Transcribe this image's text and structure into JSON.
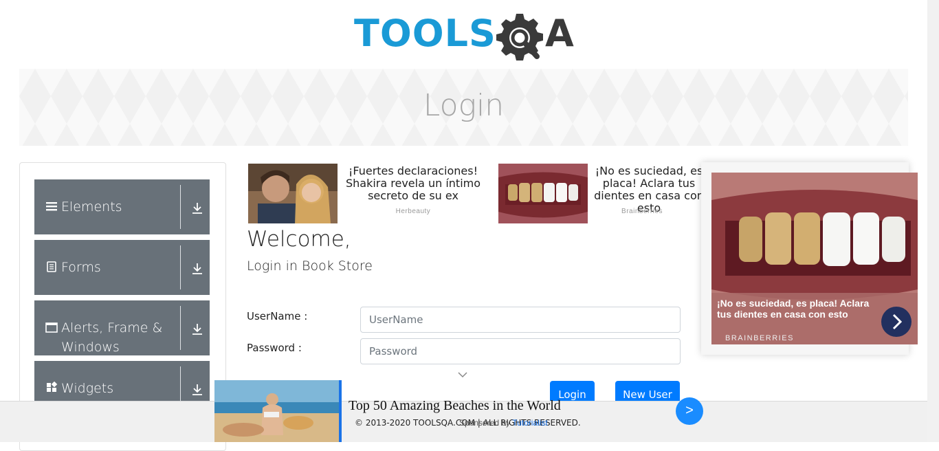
{
  "header": {
    "logo_text": "TOOLS",
    "logo_suffix": "A"
  },
  "banner": {
    "title": "Login"
  },
  "sidebar": {
    "groups": [
      {
        "label": "Elements",
        "icon": "hamburger-icon"
      },
      {
        "label": "Forms",
        "icon": "document-icon"
      },
      {
        "label": "Alerts, Frame & Windows",
        "icon": "window-icon"
      },
      {
        "label": "Widgets",
        "icon": "widgets-icon"
      }
    ]
  },
  "ads": {
    "card1": {
      "text": "¡Fuertes declaraciones! Shakira revela un íntimo secreto de su ex",
      "source": "Herbeauty"
    },
    "card2": {
      "text": "¡No es suciedad, es placa! Aclara tus dientes en casa con esto",
      "source": "Brainberries"
    },
    "side": {
      "caption": "¡No es suciedad, es placa! Aclara tus dientes en casa con esto",
      "source": "BRAINBERRIES"
    },
    "bottom": {
      "title": "Top 50 Amazing Beaches in the World",
      "next": ">"
    }
  },
  "login": {
    "welcome": "Welcome,",
    "subtitle": "Login in Book Store",
    "username_label": "UserName :",
    "username_placeholder": "UserName",
    "password_label": "Password :",
    "password_placeholder": "Password",
    "login_button": "Login",
    "new_user_button": "New User"
  },
  "footer": {
    "copyright": "© 2013-2020 TOOLSQA.COM | ALL RIGHTS RESERVED.",
    "sponsored_prefix": "Sponsored by",
    "sponsored_brand": "Tutorialist"
  },
  "colors": {
    "accent": "#007bff",
    "sidebar": "#687179",
    "logo_blue": "#1a9ad6"
  }
}
